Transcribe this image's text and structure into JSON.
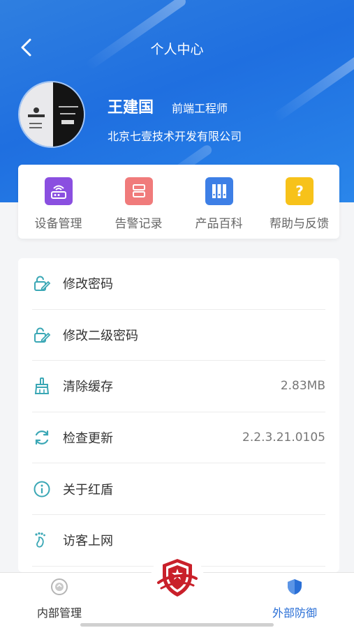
{
  "header": {
    "title": "个人中心",
    "back_icon": "chevron-left-icon"
  },
  "profile": {
    "name": "王建国",
    "role": "前端工程师",
    "company": "北京七壹技术开发有限公司"
  },
  "quick_actions": [
    {
      "label": "设备管理",
      "icon": "router-icon",
      "color": "#8a4fe0"
    },
    {
      "label": "告警记录",
      "icon": "alarm-record-icon",
      "color": "#f07b7b"
    },
    {
      "label": "产品百科",
      "icon": "catalog-icon",
      "color": "#3d7fe6"
    },
    {
      "label": "帮助与反馈",
      "icon": "help-icon",
      "color": "#f7c21a"
    }
  ],
  "menu": [
    {
      "label": "修改密码",
      "icon": "edit-lock-icon",
      "value": ""
    },
    {
      "label": "修改二级密码",
      "icon": "edit-lock-2-icon",
      "value": ""
    },
    {
      "label": "清除缓存",
      "icon": "broom-icon",
      "value": "2.83MB"
    },
    {
      "label": "检查更新",
      "icon": "refresh-icon",
      "value": "2.2.3.21.0105"
    },
    {
      "label": "关于红盾",
      "icon": "info-icon",
      "value": ""
    },
    {
      "label": "访客上网",
      "icon": "footprint-icon",
      "value": ""
    }
  ],
  "tabbar": {
    "left": {
      "label": "内部管理",
      "icon": "internal-management-icon",
      "color": "#333333"
    },
    "right": {
      "label": "外部防御",
      "icon": "shield-icon",
      "color": "#2a6fd6"
    },
    "center_icon": "red-shield-logo"
  },
  "colors": {
    "brand_blue": "#1f6fe0",
    "menu_icon_teal": "#3aa7b5",
    "active_tab": "#2a6fd6"
  }
}
